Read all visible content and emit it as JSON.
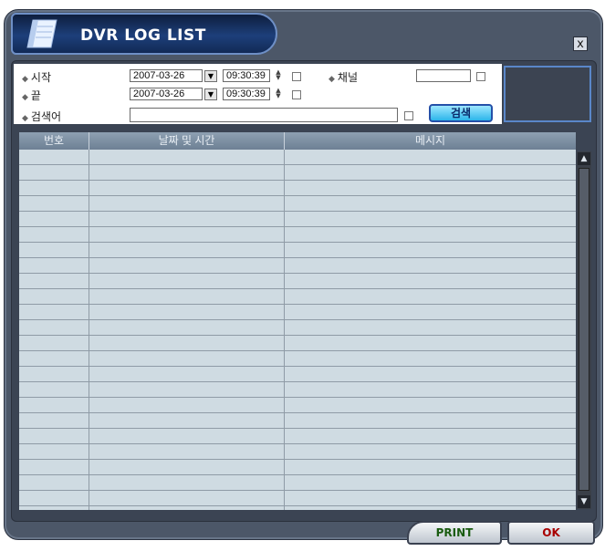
{
  "window": {
    "title": "DVR LOG LIST",
    "close_label": "x"
  },
  "search": {
    "start_label": "시작",
    "end_label": "끝",
    "keyword_label": "검색어",
    "channel_label": "채널",
    "start_date": "2007-03-26",
    "start_time": "09:30:39",
    "end_date": "2007-03-26",
    "end_time": "09:30:39",
    "channel_value": "",
    "keyword_value": "",
    "search_button": "검색"
  },
  "table": {
    "columns": [
      "번호",
      "날짜 및 시간",
      "메시지"
    ],
    "rows": []
  },
  "footer": {
    "print_button": "PRINT",
    "ok_button": "OK"
  },
  "colors": {
    "frame": "#4c5768",
    "title_tab": "#1d3f7a",
    "grid_bg": "#cfdbe2",
    "accent_button": "#2bb5ea"
  }
}
